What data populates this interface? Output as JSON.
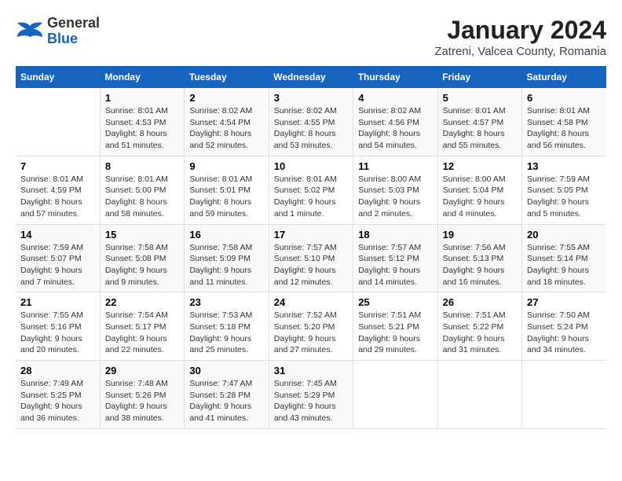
{
  "logo": {
    "line1": "General",
    "line2": "Blue"
  },
  "title": "January 2024",
  "subtitle": "Zatreni, Valcea County, Romania",
  "days_of_week": [
    "Sunday",
    "Monday",
    "Tuesday",
    "Wednesday",
    "Thursday",
    "Friday",
    "Saturday"
  ],
  "weeks": [
    [
      {
        "day": "",
        "sunrise": "",
        "sunset": "",
        "daylight": ""
      },
      {
        "day": "1",
        "sunrise": "Sunrise: 8:01 AM",
        "sunset": "Sunset: 4:53 PM",
        "daylight": "Daylight: 8 hours and 51 minutes."
      },
      {
        "day": "2",
        "sunrise": "Sunrise: 8:02 AM",
        "sunset": "Sunset: 4:54 PM",
        "daylight": "Daylight: 8 hours and 52 minutes."
      },
      {
        "day": "3",
        "sunrise": "Sunrise: 8:02 AM",
        "sunset": "Sunset: 4:55 PM",
        "daylight": "Daylight: 8 hours and 53 minutes."
      },
      {
        "day": "4",
        "sunrise": "Sunrise: 8:02 AM",
        "sunset": "Sunset: 4:56 PM",
        "daylight": "Daylight: 8 hours and 54 minutes."
      },
      {
        "day": "5",
        "sunrise": "Sunrise: 8:01 AM",
        "sunset": "Sunset: 4:57 PM",
        "daylight": "Daylight: 8 hours and 55 minutes."
      },
      {
        "day": "6",
        "sunrise": "Sunrise: 8:01 AM",
        "sunset": "Sunset: 4:58 PM",
        "daylight": "Daylight: 8 hours and 56 minutes."
      }
    ],
    [
      {
        "day": "7",
        "sunrise": "Sunrise: 8:01 AM",
        "sunset": "Sunset: 4:59 PM",
        "daylight": "Daylight: 8 hours and 57 minutes."
      },
      {
        "day": "8",
        "sunrise": "Sunrise: 8:01 AM",
        "sunset": "Sunset: 5:00 PM",
        "daylight": "Daylight: 8 hours and 58 minutes."
      },
      {
        "day": "9",
        "sunrise": "Sunrise: 8:01 AM",
        "sunset": "Sunset: 5:01 PM",
        "daylight": "Daylight: 8 hours and 59 minutes."
      },
      {
        "day": "10",
        "sunrise": "Sunrise: 8:01 AM",
        "sunset": "Sunset: 5:02 PM",
        "daylight": "Daylight: 9 hours and 1 minute."
      },
      {
        "day": "11",
        "sunrise": "Sunrise: 8:00 AM",
        "sunset": "Sunset: 5:03 PM",
        "daylight": "Daylight: 9 hours and 2 minutes."
      },
      {
        "day": "12",
        "sunrise": "Sunrise: 8:00 AM",
        "sunset": "Sunset: 5:04 PM",
        "daylight": "Daylight: 9 hours and 4 minutes."
      },
      {
        "day": "13",
        "sunrise": "Sunrise: 7:59 AM",
        "sunset": "Sunset: 5:05 PM",
        "daylight": "Daylight: 9 hours and 5 minutes."
      }
    ],
    [
      {
        "day": "14",
        "sunrise": "Sunrise: 7:59 AM",
        "sunset": "Sunset: 5:07 PM",
        "daylight": "Daylight: 9 hours and 7 minutes."
      },
      {
        "day": "15",
        "sunrise": "Sunrise: 7:58 AM",
        "sunset": "Sunset: 5:08 PM",
        "daylight": "Daylight: 9 hours and 9 minutes."
      },
      {
        "day": "16",
        "sunrise": "Sunrise: 7:58 AM",
        "sunset": "Sunset: 5:09 PM",
        "daylight": "Daylight: 9 hours and 11 minutes."
      },
      {
        "day": "17",
        "sunrise": "Sunrise: 7:57 AM",
        "sunset": "Sunset: 5:10 PM",
        "daylight": "Daylight: 9 hours and 12 minutes."
      },
      {
        "day": "18",
        "sunrise": "Sunrise: 7:57 AM",
        "sunset": "Sunset: 5:12 PM",
        "daylight": "Daylight: 9 hours and 14 minutes."
      },
      {
        "day": "19",
        "sunrise": "Sunrise: 7:56 AM",
        "sunset": "Sunset: 5:13 PM",
        "daylight": "Daylight: 9 hours and 16 minutes."
      },
      {
        "day": "20",
        "sunrise": "Sunrise: 7:55 AM",
        "sunset": "Sunset: 5:14 PM",
        "daylight": "Daylight: 9 hours and 18 minutes."
      }
    ],
    [
      {
        "day": "21",
        "sunrise": "Sunrise: 7:55 AM",
        "sunset": "Sunset: 5:16 PM",
        "daylight": "Daylight: 9 hours and 20 minutes."
      },
      {
        "day": "22",
        "sunrise": "Sunrise: 7:54 AM",
        "sunset": "Sunset: 5:17 PM",
        "daylight": "Daylight: 9 hours and 22 minutes."
      },
      {
        "day": "23",
        "sunrise": "Sunrise: 7:53 AM",
        "sunset": "Sunset: 5:18 PM",
        "daylight": "Daylight: 9 hours and 25 minutes."
      },
      {
        "day": "24",
        "sunrise": "Sunrise: 7:52 AM",
        "sunset": "Sunset: 5:20 PM",
        "daylight": "Daylight: 9 hours and 27 minutes."
      },
      {
        "day": "25",
        "sunrise": "Sunrise: 7:51 AM",
        "sunset": "Sunset: 5:21 PM",
        "daylight": "Daylight: 9 hours and 29 minutes."
      },
      {
        "day": "26",
        "sunrise": "Sunrise: 7:51 AM",
        "sunset": "Sunset: 5:22 PM",
        "daylight": "Daylight: 9 hours and 31 minutes."
      },
      {
        "day": "27",
        "sunrise": "Sunrise: 7:50 AM",
        "sunset": "Sunset: 5:24 PM",
        "daylight": "Daylight: 9 hours and 34 minutes."
      }
    ],
    [
      {
        "day": "28",
        "sunrise": "Sunrise: 7:49 AM",
        "sunset": "Sunset: 5:25 PM",
        "daylight": "Daylight: 9 hours and 36 minutes."
      },
      {
        "day": "29",
        "sunrise": "Sunrise: 7:48 AM",
        "sunset": "Sunset: 5:26 PM",
        "daylight": "Daylight: 9 hours and 38 minutes."
      },
      {
        "day": "30",
        "sunrise": "Sunrise: 7:47 AM",
        "sunset": "Sunset: 5:28 PM",
        "daylight": "Daylight: 9 hours and 41 minutes."
      },
      {
        "day": "31",
        "sunrise": "Sunrise: 7:45 AM",
        "sunset": "Sunset: 5:29 PM",
        "daylight": "Daylight: 9 hours and 43 minutes."
      },
      {
        "day": "",
        "sunrise": "",
        "sunset": "",
        "daylight": ""
      },
      {
        "day": "",
        "sunrise": "",
        "sunset": "",
        "daylight": ""
      },
      {
        "day": "",
        "sunrise": "",
        "sunset": "",
        "daylight": ""
      }
    ]
  ]
}
